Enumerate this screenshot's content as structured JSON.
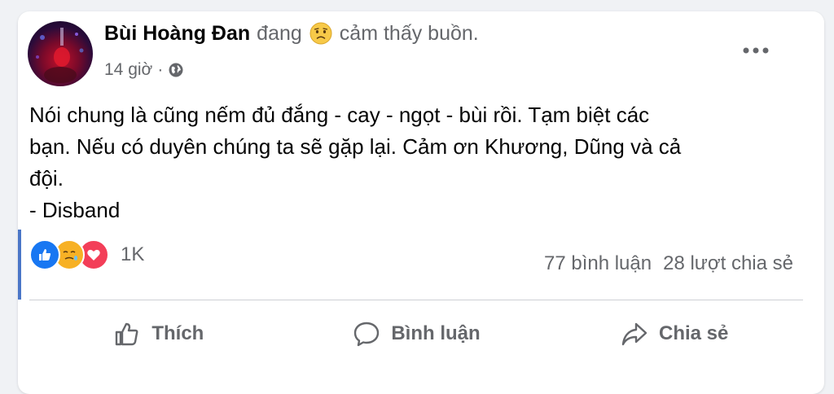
{
  "post": {
    "author": "Bùi Hoàng Đan",
    "feeling_prefix": "đang",
    "feeling_icon": "sad-face-icon",
    "feeling_text": "cảm thấy buồn.",
    "time": "14 giờ",
    "separator": "·",
    "privacy_icon": "globe-icon",
    "more_icon": "more-options-icon",
    "text": "Nói chung là cũng nếm đủ đắng - cay - ngọt - bùi rồi. Tạm biệt các\nbạn. Nếu có duyên chúng ta sẽ gặp lại. Cảm ơn Khương, Dũng và cả\nđội.\n- Disband"
  },
  "reactions": {
    "icons": [
      "like-icon",
      "care-icon",
      "love-icon"
    ],
    "count": "1K"
  },
  "stats": {
    "comments": "77 bình luận",
    "shares": "28 lượt chia sẻ"
  },
  "actions": {
    "like_label": "Thích",
    "comment_label": "Bình luận",
    "share_label": "Chia sẻ"
  },
  "colors": {
    "primary_text": "#050505",
    "secondary_text": "#65676b",
    "like_blue": "#1877f2",
    "love_red": "#f33e58",
    "care_yellow": "#f7b125"
  }
}
